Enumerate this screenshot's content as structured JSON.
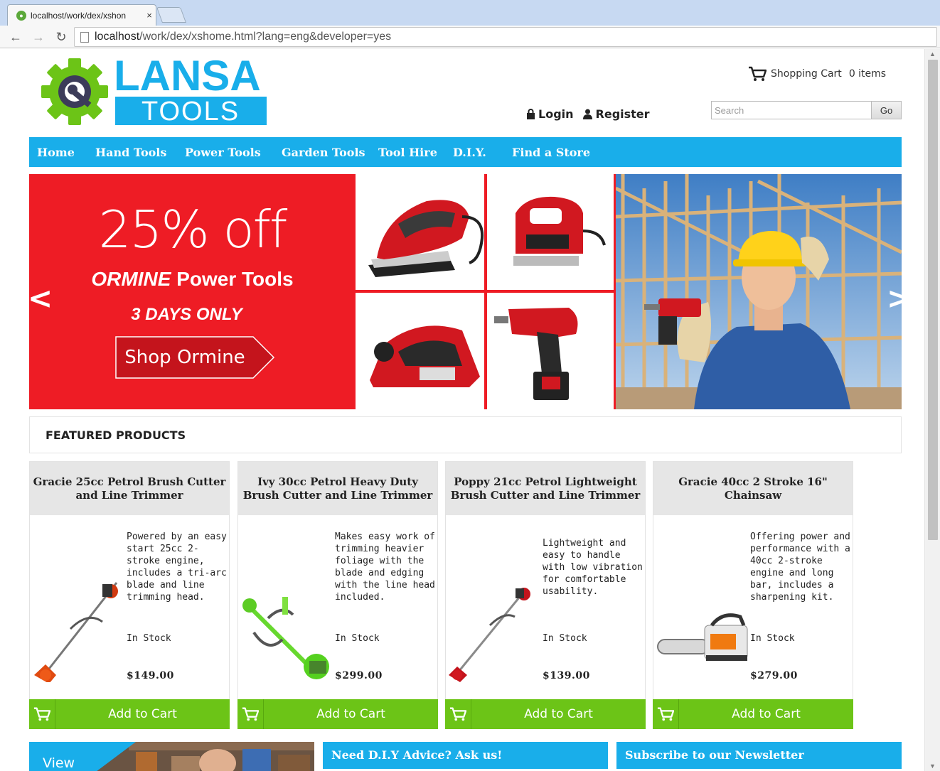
{
  "browser": {
    "tab_title": "localhost/work/dex/xshon",
    "url_host": "localhost",
    "url_rest": "/work/dex/xshome.html?lang=eng&developer=yes"
  },
  "header": {
    "logo_top": "LANSA",
    "logo_bottom": "TOOLS",
    "cart_label": "Shopping Cart",
    "cart_count": "0 items",
    "login": "Login",
    "register": "Register",
    "search_placeholder": "Search",
    "search_button": "Go"
  },
  "nav": [
    {
      "label": "Home"
    },
    {
      "label": "Hand Tools"
    },
    {
      "label": "Power Tools"
    },
    {
      "label": "Garden Tools"
    },
    {
      "label": "Tool Hire"
    },
    {
      "label": "D.I.Y."
    },
    {
      "label": "Find a Store"
    }
  ],
  "banner": {
    "headline": "25% off",
    "brand": "ORMINE",
    "brand_suffix": "Power Tools",
    "days": "3 DAYS ONLY",
    "cta": "Shop Ormine",
    "prev": "<",
    "next": ">"
  },
  "featured": {
    "heading": "FEATURED PRODUCTS",
    "products": [
      {
        "name": "Gracie 25cc Petrol Brush Cutter and Line Trimmer",
        "description": "Powered by an easy start 25cc 2-stroke engine, includes a tri-arc blade and line trimming head.",
        "stock": "In Stock",
        "price": "$149.00",
        "cart_label": "Add to Cart",
        "image": "brush-cutter-orange"
      },
      {
        "name": "Ivy 30cc Petrol Heavy Duty Brush Cutter and Line Trimmer",
        "description": "Makes easy work of trimming heavier foliage with the blade and edging with the line head included.",
        "stock": "In Stock",
        "price": "$299.00",
        "cart_label": "Add to Cart",
        "image": "brush-cutter-green"
      },
      {
        "name": "Poppy 21cc Petrol Lightweight Brush Cutter and Line Trimmer",
        "description": "Lightweight and easy to handle with low vibration for comfortable usability.",
        "stock": "In Stock",
        "price": "$139.00",
        "cart_label": "Add to Cart",
        "image": "brush-cutter-red"
      },
      {
        "name": "Gracie 40cc 2 Stroke 16\" Chainsaw",
        "description": "Offering power and performance with a 40cc 2-stroke engine and long bar, includes a sharpening kit.",
        "stock": "In Stock",
        "price": "$279.00",
        "cart_label": "Add to Cart",
        "image": "chainsaw"
      }
    ]
  },
  "bottom": {
    "view_label": "View",
    "advice_title": "Need D.I.Y Advice?  Ask us!",
    "newsletter_title": "Subscribe to our Newsletter"
  },
  "colors": {
    "brand_blue": "#19aeea",
    "promo_red": "#ee1c25",
    "cart_green": "#6cc417",
    "logo_green": "#6cc417"
  }
}
